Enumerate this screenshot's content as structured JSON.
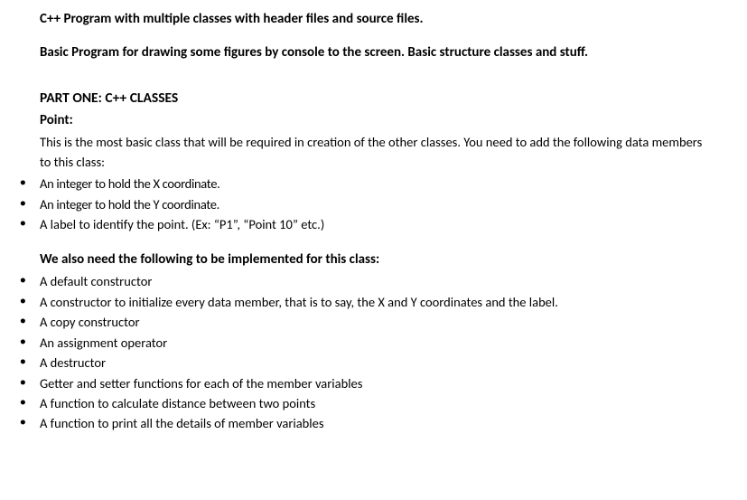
{
  "title": "C++ Program with multiple classes with header files and source files.",
  "subtitle": "Basic Program for drawing some figures by console to the screen. Basic structure classes and stuff.",
  "part_heading": "PART ONE: C++ CLASSES",
  "class1": {
    "name": "Point:",
    "intro": "This is the most basic class that will be required in creation of the other classes. You need to add the following data members to this class:",
    "members": [
      "An integer to hold the X coordinate.",
      "An integer to hold the Y coordinate.",
      "A label to identify the point. (Ex: “P1”, “Point 10” etc.)"
    ],
    "impl_heading": "We also need the following to be implemented for this class:",
    "impl": [
      "A default constructor",
      "A constructor to initialize every data member, that is to say, the X and Y coordinates and the label.",
      "A copy constructor",
      "An assignment operator",
      "A destructor",
      "Getter and setter functions for each of the member variables",
      "A function to calculate distance between two points",
      "A function to print all the details of member variables"
    ]
  }
}
